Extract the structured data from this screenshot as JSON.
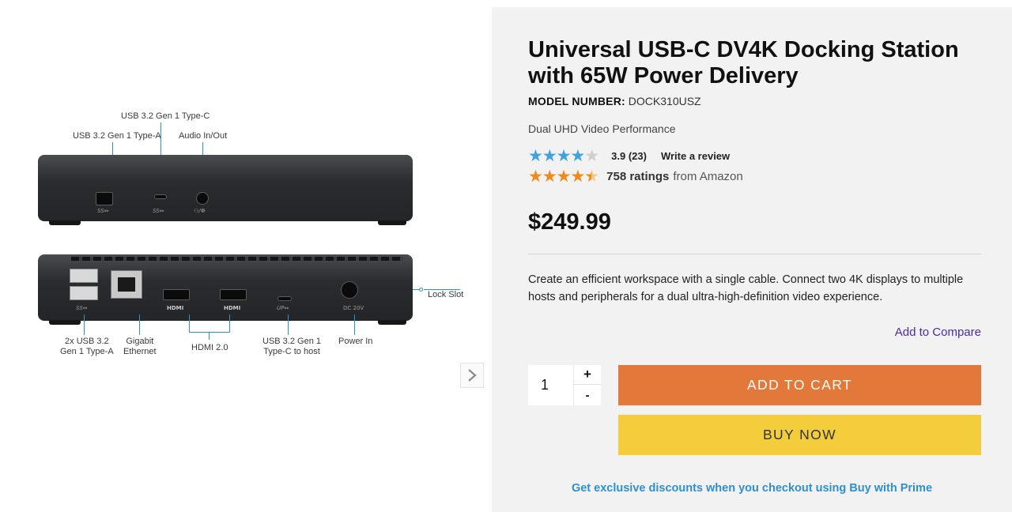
{
  "gallery": {
    "callouts": {
      "usb_c_top": "USB 3.2 Gen 1 Type-C",
      "usb_a_top": "USB 3.2 Gen 1 Type-A",
      "audio": "Audio In/Out",
      "lock_slot": "Lock Slot",
      "usb_a_rear_line1": "2x USB 3.2",
      "usb_a_rear_line2": "Gen 1 Type-A",
      "ethernet_line1": "Gigabit",
      "ethernet_line2": "Ethernet",
      "hdmi": "HDMI 2.0",
      "usb_c_host_line1": "USB 3.2 Gen 1",
      "usb_c_host_line2": "Type-C to host",
      "power_in": "Power In"
    },
    "port_labels": {
      "ss_a": "SS↭",
      "ss_c": "SS↭",
      "audio": "⚇/☸",
      "ss_rear": "SS↭",
      "hdmi1": "HDMI",
      "hdmi2": "HDMI",
      "up": "UP↭",
      "dc": "DC 20V"
    },
    "next_icon": "chevron-right"
  },
  "product": {
    "title": "Universal USB-C DV4K Docking Station with 65W Power Delivery",
    "model_label": "MODEL NUMBER:",
    "model_value": "DOCK310USZ",
    "subtitle": "Dual UHD Video Performance",
    "rating": {
      "stars": "★★★★★",
      "value": 3.9,
      "score_text": "3.9 (23)",
      "write_review": "Write a review",
      "color": "#3fa3dd"
    },
    "amazon": {
      "stars": "★★★★★",
      "value": 4.5,
      "count_text": "758 ratings",
      "from_text": "from Amazon",
      "color": "#f08a1c"
    },
    "price": "$249.99",
    "description": "Create an efficient workspace with a single cable. Connect two 4K displays to multiple hosts and peripherals for a dual ultra-high-definition video experience.",
    "compare": "Add to Compare",
    "quantity": {
      "value": "1",
      "plus": "+",
      "minus": "-"
    },
    "add_to_cart": "ADD TO CART",
    "buy_now": "BUY NOW",
    "prime_text": "Get exclusive discounts when you checkout using Buy with Prime"
  },
  "colors": {
    "cart_button": "#e2793a",
    "buy_button": "#f4cd3d",
    "link_purple": "#4b2aa8",
    "link_blue": "#2f8fd0",
    "panel_bg": "#f2f2f2"
  }
}
